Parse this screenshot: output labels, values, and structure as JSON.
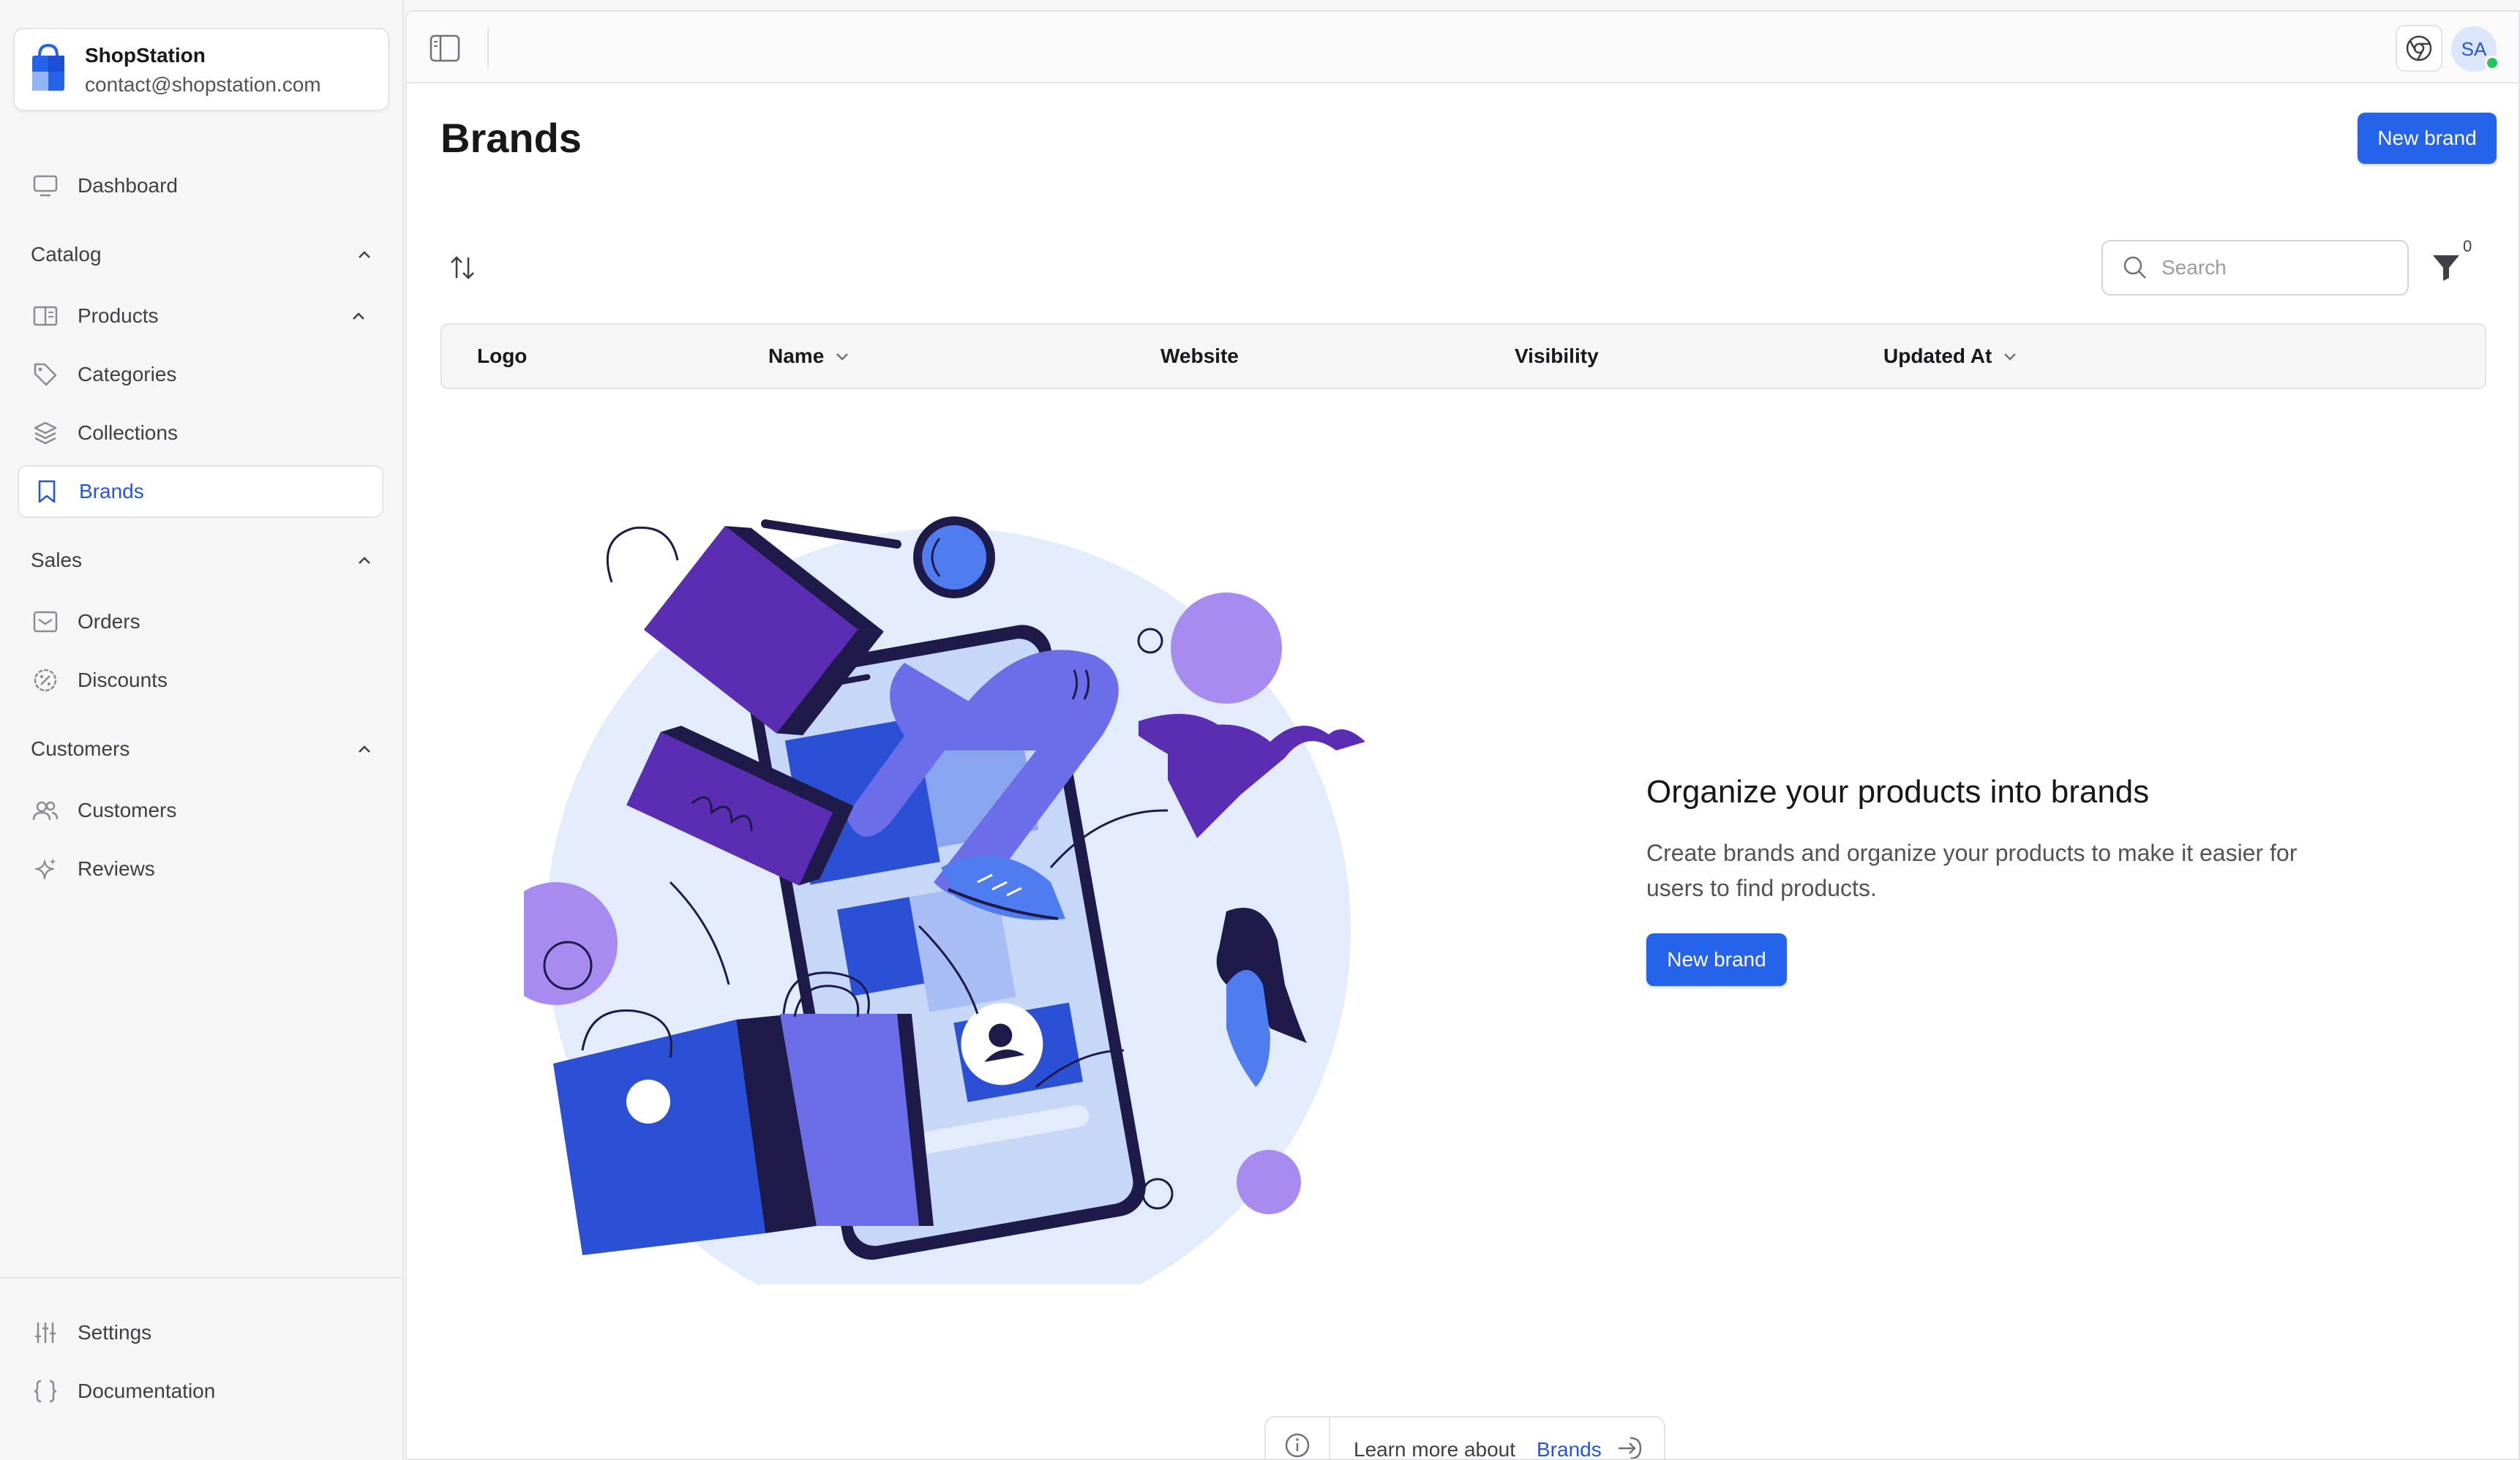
{
  "org": {
    "name": "ShopStation",
    "email": "contact@shopstation.com"
  },
  "sidebar": {
    "dashboard": "Dashboard",
    "sections": {
      "catalog": "Catalog",
      "sales": "Sales",
      "customers": "Customers"
    },
    "catalog_items": [
      "Products",
      "Categories",
      "Collections",
      "Brands"
    ],
    "sales_items": [
      "Orders",
      "Discounts"
    ],
    "customer_items": [
      "Customers",
      "Reviews"
    ],
    "bottom_items": [
      "Settings",
      "Documentation"
    ],
    "active_item": "Brands"
  },
  "header": {
    "avatar_initials": "SA"
  },
  "page": {
    "title": "Brands",
    "new_button": "New brand",
    "search_placeholder": "Search",
    "filter_count": "0"
  },
  "table": {
    "columns": [
      "Logo",
      "Name",
      "Website",
      "Visibility",
      "Updated At"
    ]
  },
  "empty_state": {
    "title": "Organize your products into brands",
    "description": "Create brands and organize your products to make it easier for users to find products.",
    "button": "New brand"
  },
  "learn_more": {
    "text": "Learn more about",
    "link": "Brands"
  },
  "colors": {
    "accent": "#2563eb",
    "active_text": "#2556d9",
    "illustration_purple": "#5b2db3",
    "illustration_violet": "#6b6ee8",
    "illustration_lilac": "#a78bf0",
    "illustration_bg": "#e3ecfb"
  }
}
